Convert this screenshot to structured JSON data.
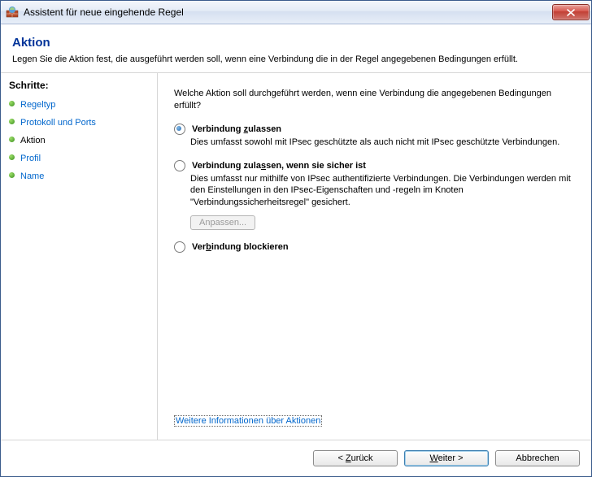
{
  "window": {
    "title": "Assistent für neue eingehende Regel"
  },
  "header": {
    "title": "Aktion",
    "subtitle": "Legen Sie die Aktion fest, die ausgeführt werden soll, wenn eine Verbindung die in der Regel angegebenen Bedingungen erfüllt."
  },
  "sidebar": {
    "title": "Schritte:",
    "steps": [
      {
        "label": "Regeltyp",
        "state": "link"
      },
      {
        "label": "Protokoll und Ports",
        "state": "link"
      },
      {
        "label": "Aktion",
        "state": "current"
      },
      {
        "label": "Profil",
        "state": "link"
      },
      {
        "label": "Name",
        "state": "link"
      }
    ]
  },
  "content": {
    "prompt": "Welche Aktion soll durchgeführt werden, wenn eine Verbindung die angegebenen Bedingungen erfüllt?",
    "options": [
      {
        "label": "Verbindung zulassen",
        "underline_char": "z",
        "checked": true,
        "desc": "Dies umfasst sowohl mit IPsec geschützte als auch nicht mit IPsec geschützte Verbindungen."
      },
      {
        "label": "Verbindung zulassen, wenn sie sicher ist",
        "underline_char": "s",
        "checked": false,
        "desc": "Dies umfasst nur mithilfe von IPsec authentifizierte Verbindungen. Die Verbindungen werden mit den Einstellungen in den IPsec-Eigenschaften und -regeln im Knoten \"Verbindungssicherheitsregel\" gesichert.",
        "customize_label": "Anpassen...",
        "customize_enabled": false
      },
      {
        "label": "Verbindung blockieren",
        "underline_char": "b",
        "checked": false
      }
    ],
    "more_link": "Weitere Informationen über Aktionen"
  },
  "footer": {
    "back": {
      "label": "Zurück",
      "underline": "Z",
      "prefix": "< "
    },
    "next": {
      "label": "Weiter >",
      "underline": "W",
      "default": true
    },
    "cancel": {
      "label": "Abbrechen"
    }
  }
}
